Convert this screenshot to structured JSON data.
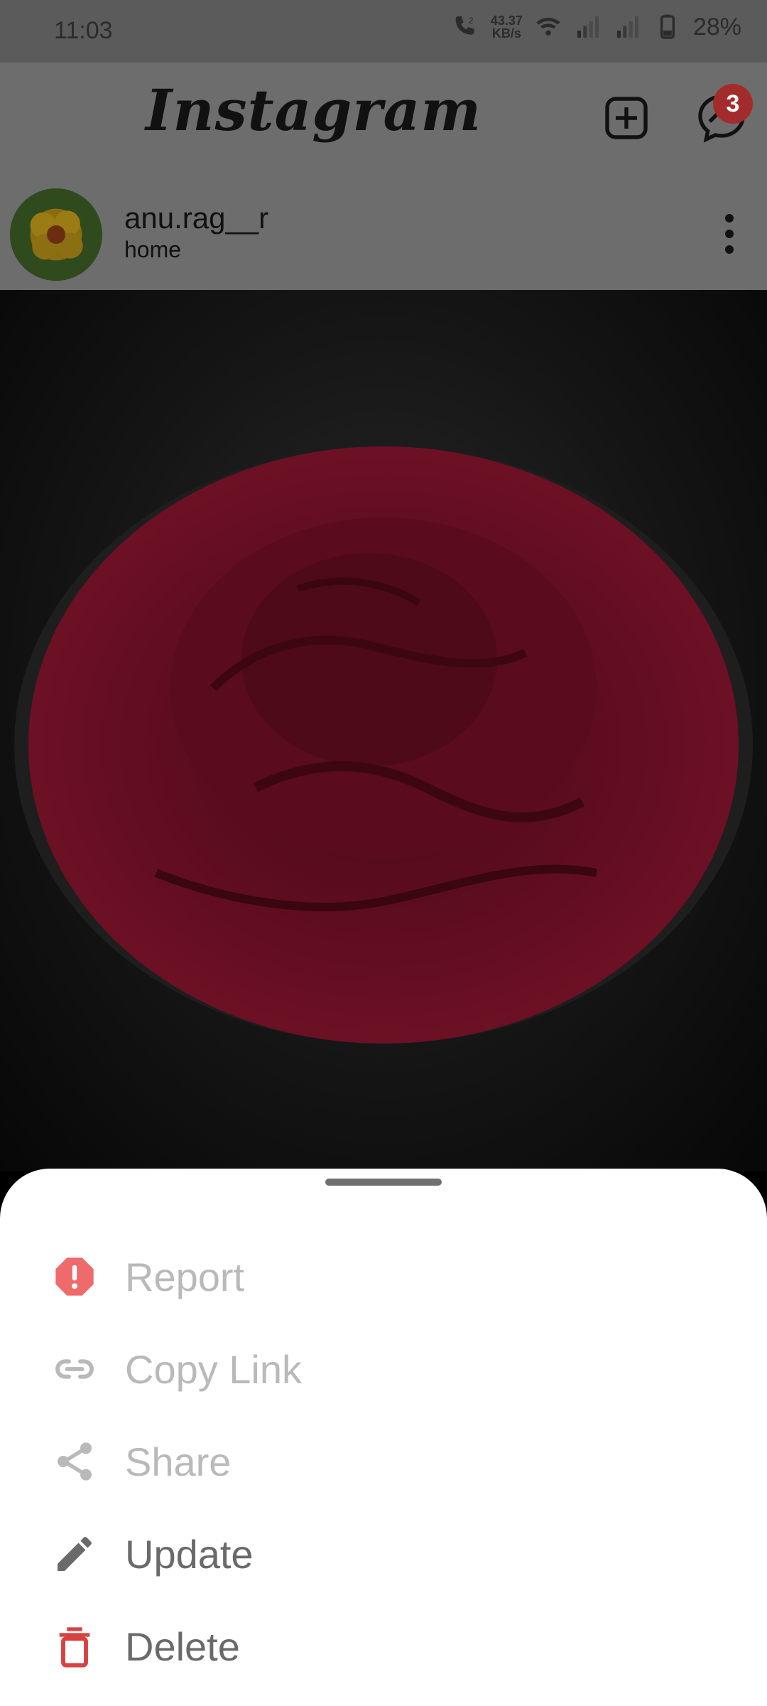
{
  "status_bar": {
    "time": "11:03",
    "net_speed_value": "43.37",
    "net_speed_unit": "KB/s",
    "battery": "28%",
    "icons": [
      "wifi-call-icon",
      "wifi-icon",
      "signal-icon",
      "signal-icon",
      "battery-icon"
    ]
  },
  "header": {
    "logo": "Instagram",
    "badge_count": "3",
    "icons": [
      "new-post-icon",
      "messenger-icon"
    ]
  },
  "post": {
    "username": "anu.rag__r",
    "location": "home"
  },
  "sheet": {
    "items": [
      {
        "label": "Report",
        "icon": "report-icon",
        "enabled": false,
        "color": "#ef6a6a"
      },
      {
        "label": "Copy Link",
        "icon": "link-icon",
        "enabled": false,
        "color": "#b9b9b9"
      },
      {
        "label": "Share",
        "icon": "share-icon",
        "enabled": false,
        "color": "#b9b9b9"
      },
      {
        "label": "Update",
        "icon": "edit-icon",
        "enabled": true,
        "color": "#6a6a6a"
      },
      {
        "label": "Delete",
        "icon": "trash-icon",
        "enabled": true,
        "color": "#d64242"
      }
    ]
  }
}
